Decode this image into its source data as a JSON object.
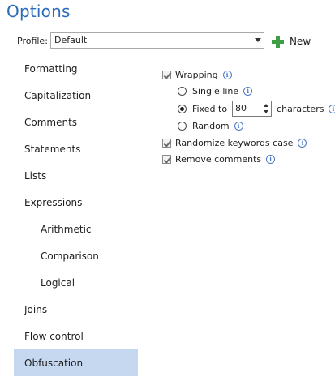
{
  "header": {
    "title": "Options"
  },
  "profile": {
    "label": "Profile:",
    "value": "Default",
    "new_label": "New"
  },
  "sidebar": {
    "items": [
      {
        "label": "Formatting"
      },
      {
        "label": "Capitalization"
      },
      {
        "label": "Comments"
      },
      {
        "label": "Statements"
      },
      {
        "label": "Lists"
      },
      {
        "label": "Expressions"
      },
      {
        "label": "Arithmetic"
      },
      {
        "label": "Comparison"
      },
      {
        "label": "Logical"
      },
      {
        "label": "Joins"
      },
      {
        "label": "Flow control"
      },
      {
        "label": "Obfuscation"
      }
    ],
    "selected": "Obfuscation"
  },
  "options": {
    "wrapping": {
      "label": "Wrapping",
      "checked": true
    },
    "single_line": {
      "label": "Single line",
      "selected": false
    },
    "fixed_to": {
      "label": "Fixed to",
      "value": "80",
      "suffix": "characters",
      "selected": true
    },
    "random": {
      "label": "Random",
      "selected": false
    },
    "randomize_keywords": {
      "label": "Randomize keywords case",
      "checked": true
    },
    "remove_comments": {
      "label": "Remove comments",
      "checked": true
    }
  },
  "colors": {
    "title": "#2b6cb8",
    "selected_item": "#c6d8f0",
    "plus": "#3c9f46",
    "info": "#4a78c4"
  }
}
